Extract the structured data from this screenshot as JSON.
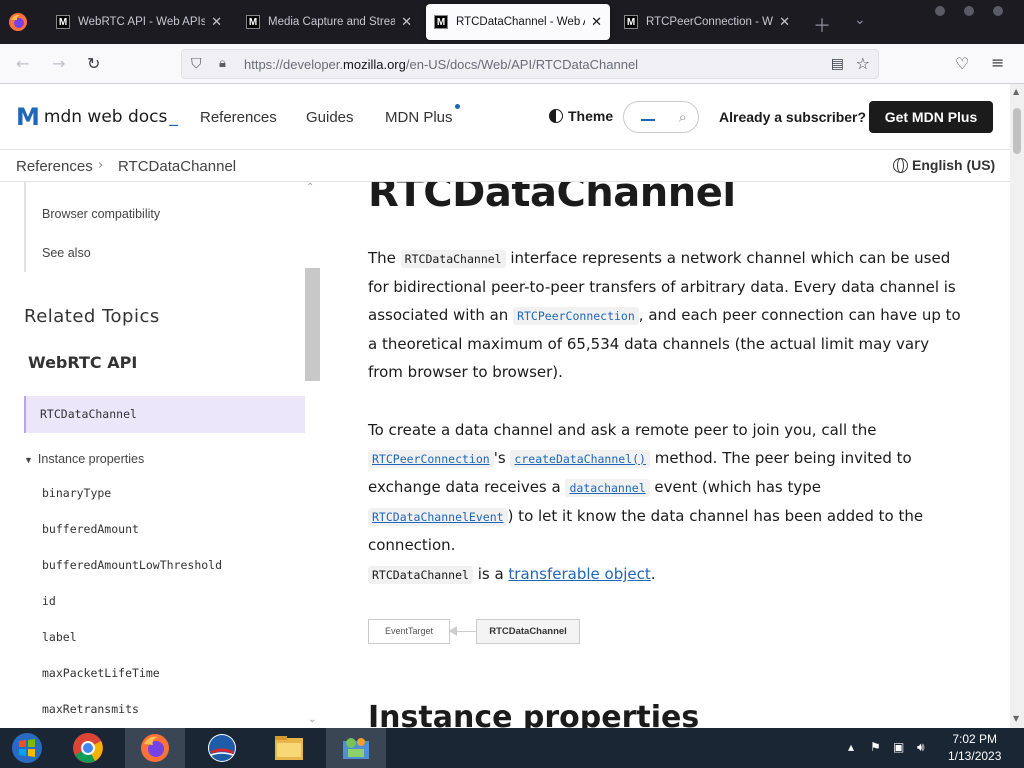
{
  "browser": {
    "tabs": [
      {
        "title": "WebRTC API - Web APIs",
        "active": false
      },
      {
        "title": "Media Capture and Streams",
        "active": false
      },
      {
        "title": "RTCDataChannel - Web APIs",
        "active": true
      },
      {
        "title": "RTCPeerConnection - Web",
        "active": false
      }
    ],
    "favicon_letter": "M",
    "url_prefix": "https://developer.",
    "url_domain": "mozilla.org",
    "url_path": "/en-US/docs/Web/API/RTCDataChannel"
  },
  "header": {
    "logo_text": "mdn web docs",
    "logo_underscore": "_",
    "nav": [
      "References",
      "Guides",
      "MDN Plus"
    ],
    "theme_label": "Theme",
    "subscriber_text": "Already a subscriber?",
    "cta_label": "Get MDN Plus"
  },
  "breadcrumb": {
    "items": [
      "References",
      "RTCDataChannel"
    ],
    "language": "English (US)"
  },
  "sidebar": {
    "toc_items": [
      "Browser compatibility",
      "See also"
    ],
    "related_heading": "Related Topics",
    "group_title": "WebRTC API",
    "active_item": "RTCDataChannel",
    "section_label": "Instance properties",
    "properties": [
      "binaryType",
      "bufferedAmount",
      "bufferedAmountLowThreshold",
      "id",
      "label",
      "maxPacketLifeTime",
      "maxRetransmits"
    ]
  },
  "article": {
    "title": "RTCDataChannel",
    "p1": {
      "t1": "The ",
      "c1": "RTCDataChannel",
      "t2": " interface represents a network channel which can be used for bidirectional peer-to-peer transfers of arbitrary data. Every data channel is associated with an ",
      "c2": "RTCPeerConnection",
      "t3": ", and each peer connection can have up to a theoretical maximum of 65,534 data channels (the actual limit may vary from browser to browser)."
    },
    "p2": {
      "t1": "To create a data channel and ask a remote peer to join you, call the ",
      "c1": "RTCPeerConnection",
      "t2": "'s ",
      "c2": "createDataChannel()",
      "t3": " method. The peer being invited to exchange data receives a ",
      "c3": "datachannel",
      "t4": " event (which has type ",
      "c4": "RTCDataChannelEvent",
      "t5": ") to let it know the data channel has been added to the connection."
    },
    "p3": {
      "c1": "RTCDataChannel",
      "t1": " is a ",
      "link": "transferable object",
      "t2": "."
    },
    "inheritance": {
      "parent": "EventTarget",
      "child": "RTCDataChannel"
    },
    "next_heading": "Instance properties"
  },
  "taskbar": {
    "time": "7:02 PM",
    "date": "1/13/2023"
  },
  "colors": {
    "link": "#1e67b9",
    "active_bg": "#ece6fb",
    "taskbar": "#1a2633",
    "tabbar": "#1c1b22"
  }
}
